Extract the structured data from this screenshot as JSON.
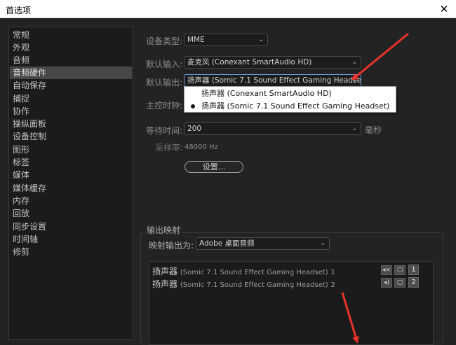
{
  "window": {
    "title": "首选项",
    "close_glyph": "✕"
  },
  "sidebar": {
    "items": [
      "常规",
      "外观",
      "音频",
      "音频硬件",
      "自动保存",
      "捕捉",
      "协作",
      "操纵面板",
      "设备控制",
      "图形",
      "标签",
      "媒体",
      "媒体缓存",
      "内存",
      "回放",
      "同步设置",
      "时间轴",
      "修剪"
    ],
    "active_index": 3
  },
  "audio_hardware": {
    "device_class_label": "设备类型:",
    "device_class_value": "MME",
    "default_input_label": "默认输入:",
    "default_input_value": "麦克风 (Conexant SmartAudio HD)",
    "default_output_label": "默认输出:",
    "default_output_value": "扬声器 (Somic 7.1 Sound Effect Gaming Headset)",
    "master_clock_label": "主控时钟:",
    "latency_label": "等待时间:",
    "latency_value": "200",
    "latency_unit": "毫秒",
    "sample_rate_label": "采样率:",
    "sample_rate_value": "48000 Hz",
    "settings_button": "设置..."
  },
  "output_dropdown": {
    "options": [
      {
        "label": "扬声器 (Conexant SmartAudio HD)",
        "selected": false
      },
      {
        "label": "扬声器 (Somic 7.1 Sound Effect Gaming Headset)",
        "selected": true
      }
    ]
  },
  "output_mapping": {
    "section_title": "输出映射",
    "map_output_label": "映射输出为:",
    "map_output_value": "Adobe 桌面音频",
    "rows": [
      {
        "main": "扬声器",
        "device": "(Somic 7.1 Sound Effect Gaming Headset)",
        "channel": "1",
        "channel_number": "1"
      },
      {
        "main": "扬声器",
        "device": "(Somic 7.1 Sound Effect Gaming Headset)",
        "channel": "2",
        "channel_number": "2"
      }
    ]
  },
  "colors": {
    "annotation_arrow": "#e8322a",
    "accent_focus": "#6a9ad8",
    "panel_bg": "#232323"
  },
  "icons": [
    "close-icon",
    "dropdown-caret-icon",
    "speaker-mute-icon",
    "speaker-icon",
    "monitor-frame-icon"
  ]
}
